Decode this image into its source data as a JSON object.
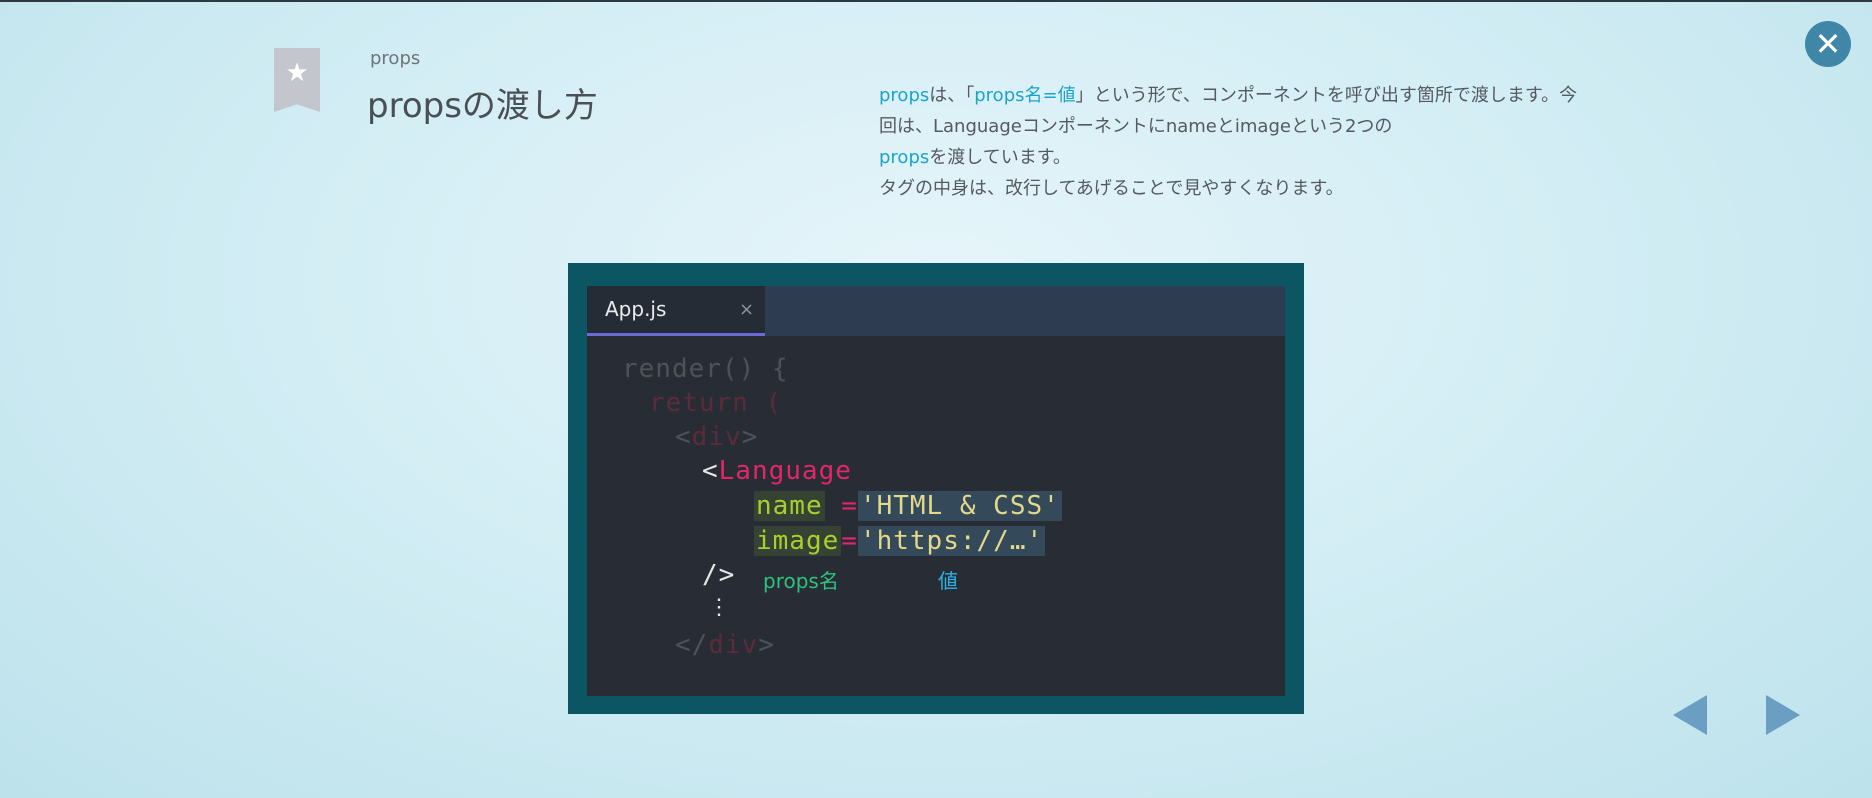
{
  "header": {
    "category": "props",
    "title": "propsの渡し方",
    "close_icon": "close-icon",
    "bookmark_icon": "star-icon"
  },
  "description": {
    "p1_hl1": "props",
    "p1_t1": "は、「",
    "p1_hl2": "props名=値",
    "p1_t2": "」という形で、コンポーネントを呼び出す箇所で渡します。今回は、Languageコンポーネントにnameとimageという2つの",
    "p1_hl3": "props",
    "p1_t3": "を渡しています。",
    "p2": "タグの中身は、改行してあげることで見やすくなります。"
  },
  "editor": {
    "tab_label": "App.js",
    "tab_close": "×",
    "code": {
      "l1": "render() {",
      "l2": "return (",
      "l3_open": "<",
      "l3_tag": "div",
      "l3_close": ">",
      "l4_open": "<",
      "l4_tag": "Language",
      "l5_attr": "name",
      "l5_eq": " =",
      "l5_val": "'HTML & CSS'",
      "l6_attr": "image",
      "l6_eq": "=",
      "l6_val": "'https://…'",
      "l7": "/>",
      "l8": "⋮",
      "l9_open": "</",
      "l9_tag": "div",
      "l9_close": ">"
    },
    "annotations": {
      "name_label": "props名",
      "value_label": "値"
    }
  },
  "nav": {
    "prev_icon": "triangle-left-icon",
    "next_icon": "triangle-right-icon"
  },
  "colors": {
    "accent": "#1aa4cb",
    "frame": "#0c5664",
    "code_bg": "#282c34",
    "tab_underline": "#6a6bd9",
    "pink": "#e2266c",
    "green": "#a6d02d",
    "yellow": "#e3d98a"
  }
}
